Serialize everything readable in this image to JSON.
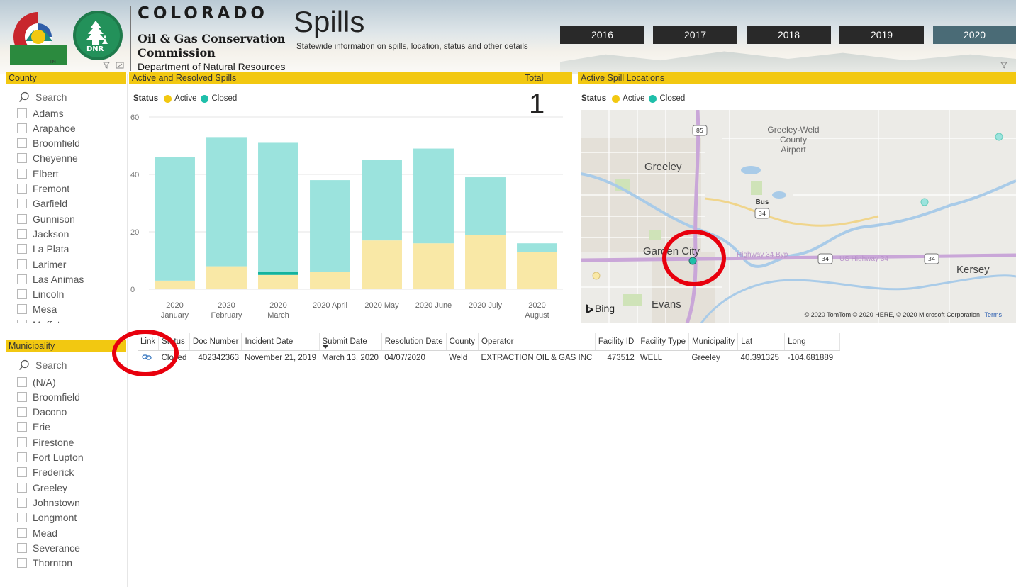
{
  "header": {
    "org_line1": "COLORADO",
    "org_line2": "Oil & Gas Conservation",
    "org_line3": "Commission",
    "org_line4": "Department of Natural Resources",
    "logo_text": "DNR",
    "title": "Spills",
    "subtitle": "Statewide information on spills, location, status and other details"
  },
  "years": [
    {
      "label": "2016",
      "selected": false
    },
    {
      "label": "2017",
      "selected": false
    },
    {
      "label": "2018",
      "selected": false
    },
    {
      "label": "2019",
      "selected": false
    },
    {
      "label": "2020",
      "selected": true
    }
  ],
  "county_slicer": {
    "title": "County",
    "search_placeholder": "Search",
    "items": [
      "Adams",
      "Arapahoe",
      "Broomfield",
      "Cheyenne",
      "Elbert",
      "Fremont",
      "Garfield",
      "Gunnison",
      "Jackson",
      "La Plata",
      "Larimer",
      "Las Animas",
      "Lincoln",
      "Mesa",
      "Moffat"
    ]
  },
  "municipality_slicer": {
    "title": "Municipality",
    "search_placeholder": "Search",
    "items": [
      "(N/A)",
      "Broomfield",
      "Dacono",
      "Erie",
      "Firestone",
      "Fort Lupton",
      "Frederick",
      "Greeley",
      "Johnstown",
      "Longmont",
      "Mead",
      "Severance",
      "Thornton"
    ]
  },
  "spills_chart": {
    "title": "Active and Resolved Spills",
    "legend_label": "Status",
    "legend_items": [
      {
        "label": "Active",
        "color": "#f2c811"
      },
      {
        "label": "Closed",
        "color": "#1fbfaa"
      }
    ]
  },
  "total_card": {
    "label": "Total",
    "value": "1"
  },
  "chart_data": {
    "type": "bar",
    "stacked": true,
    "categories": [
      [
        "2020",
        "January"
      ],
      [
        "2020",
        "February"
      ],
      [
        "2020",
        "March"
      ],
      [
        "2020 April"
      ],
      [
        "2020 May"
      ],
      [
        "2020 June"
      ],
      [
        "2020 July"
      ],
      [
        "2020",
        "August"
      ]
    ],
    "series": [
      {
        "name": "Active",
        "color": "#f9e8a6",
        "values": [
          3,
          8,
          5,
          6,
          17,
          16,
          19,
          13
        ]
      },
      {
        "name": "Closed",
        "color": "#9be3dd",
        "values": [
          43,
          45,
          46,
          32,
          28,
          33,
          20,
          3
        ]
      }
    ],
    "highlight": {
      "category_index": 2,
      "value": 1,
      "color": "#12b39d"
    },
    "ylim": [
      0,
      60
    ],
    "yticks": [
      0,
      20,
      40,
      60
    ],
    "grid": true
  },
  "map": {
    "title": "Active Spill Locations",
    "legend_label": "Status",
    "legend_items": [
      {
        "label": "Active",
        "color": "#f2c811"
      },
      {
        "label": "Closed",
        "color": "#1fbfaa"
      }
    ],
    "labels": {
      "city1": "Greeley",
      "city2": "Garden City",
      "city3": "Evans",
      "city4": "Kersey",
      "airport_line1": "Greeley-Weld",
      "airport_line2": "County",
      "airport_line3": "Airport",
      "bus": "Bus",
      "shield34": "34",
      "shield85": "85",
      "hwy_byp": "Highway 34 Byp",
      "hwy_us": "US Highway 34"
    },
    "bing": "Bing",
    "copyright": "© 2020 TomTom © 2020 HERE, © 2020 Microsoft Corporation",
    "terms": "Terms"
  },
  "table": {
    "columns": [
      "Link",
      "Status",
      "Doc Number",
      "Incident Date",
      "Submit Date",
      "Resolution Date",
      "County",
      "Operator",
      "Facility ID",
      "Facility Type",
      "Municipality",
      "Lat",
      "Long"
    ],
    "rows": [
      {
        "link_icon": "link-icon",
        "status": "Closed",
        "doc_number": "402342363",
        "incident_date": "November 21, 2019",
        "submit_date": "March 13, 2020",
        "resolution_date": "04/07/2020",
        "county": "Weld",
        "operator": "EXTRACTION OIL & GAS INC",
        "facility_id": "473512",
        "facility_type": "WELL",
        "municipality": "Greeley",
        "lat": "40.391325",
        "long": "-104.681889"
      }
    ]
  },
  "colors": {
    "accent": "#f2c811",
    "year_button": "#292929",
    "year_selected": "#4a6b76",
    "annotation": "#e8000d"
  }
}
